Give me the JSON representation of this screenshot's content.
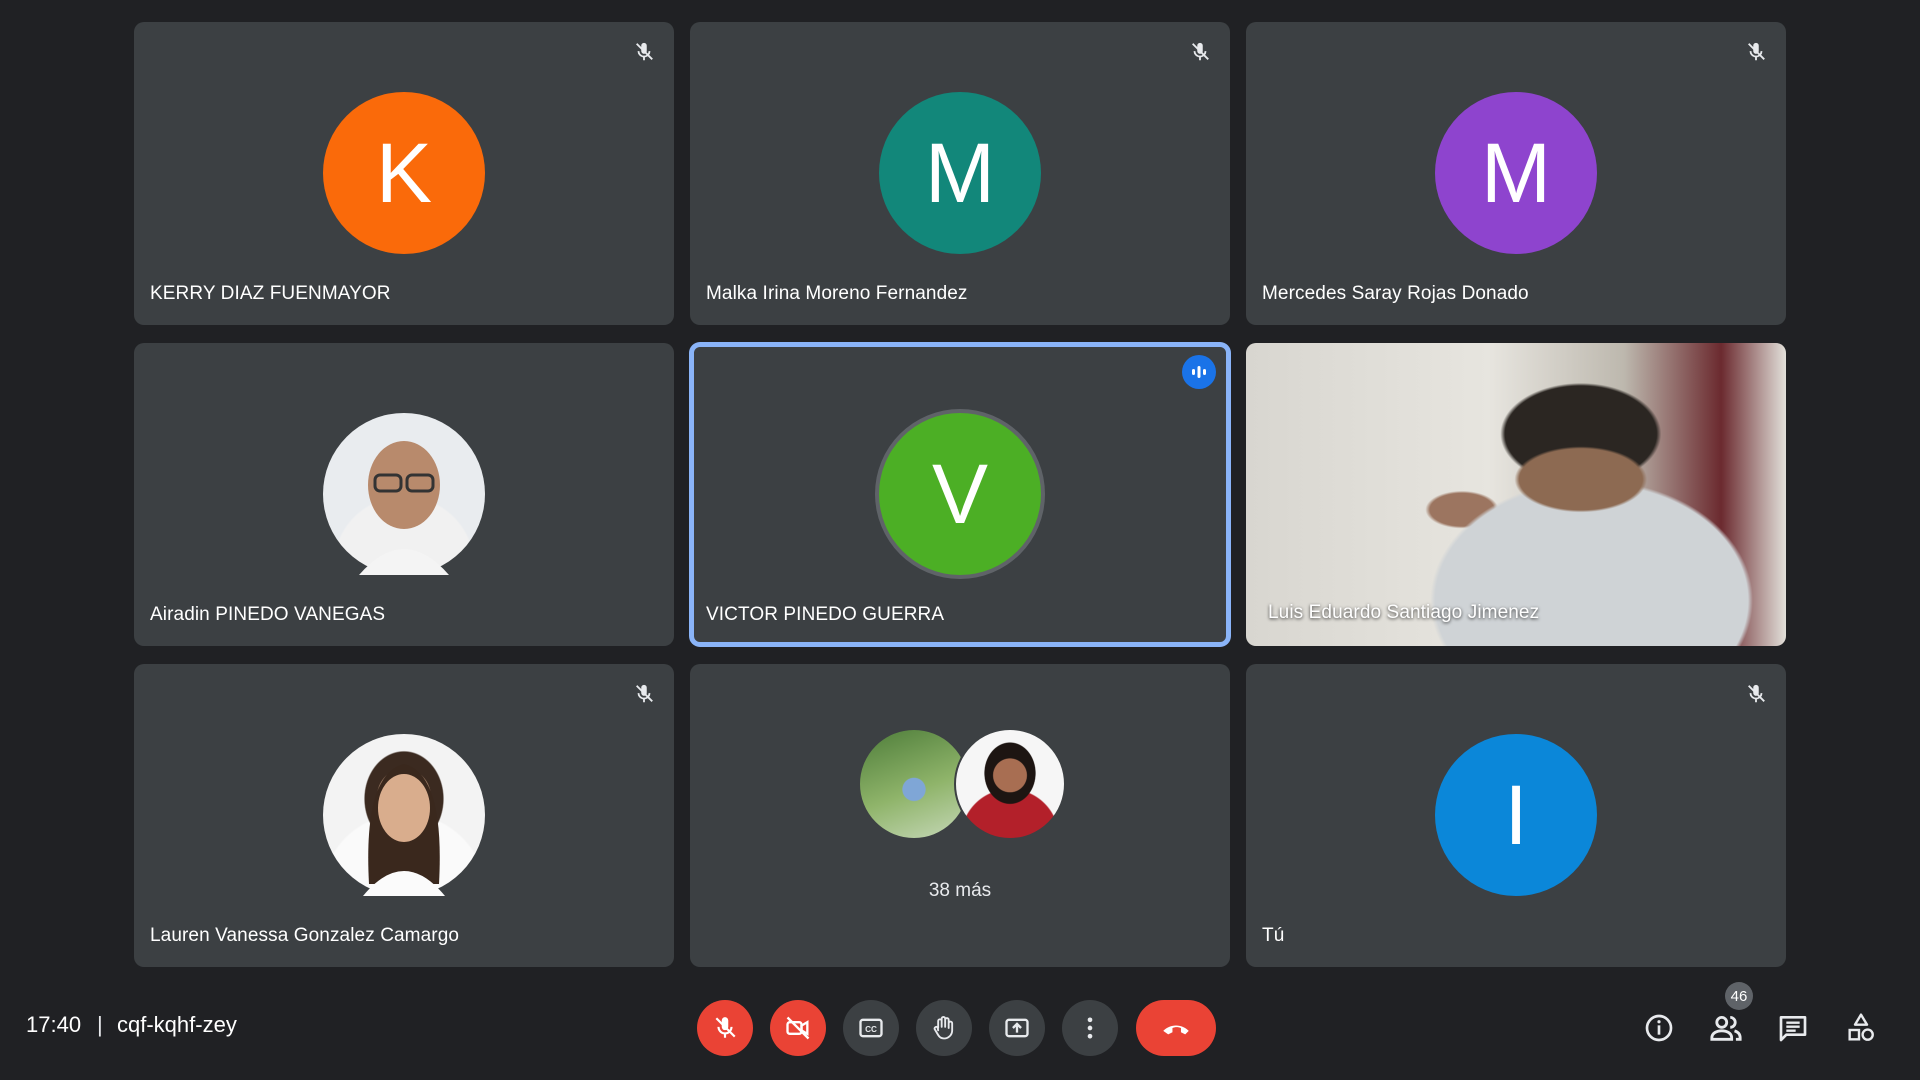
{
  "participants": [
    {
      "name": "KERRY DIAZ FUENMAYOR",
      "initial": "K",
      "avatar_color": "#fa6a0a",
      "muted": true,
      "avatar_type": "letter"
    },
    {
      "name": "Malka Irina Moreno Fernandez",
      "initial": "M",
      "avatar_color": "#12877a",
      "muted": true,
      "avatar_type": "letter"
    },
    {
      "name": "Mercedes Saray Rojas Donado",
      "initial": "M",
      "avatar_color": "#8e44ce",
      "muted": true,
      "avatar_type": "letter"
    },
    {
      "name": "Airadin PINEDO VANEGAS",
      "muted": false,
      "avatar_type": "photo"
    },
    {
      "name": "VICTOR PINEDO GUERRA",
      "initial": "V",
      "avatar_color": "#4caf25",
      "muted": false,
      "speaking": true,
      "avatar_type": "letter"
    },
    {
      "name": "Luis Eduardo Santiago Jimenez",
      "muted": false,
      "avatar_type": "video"
    },
    {
      "name": "Lauren Vanessa Gonzalez Camargo",
      "muted": true,
      "avatar_type": "photo"
    },
    {
      "name": "Tú",
      "initial": "I",
      "avatar_color": "#0b87d9",
      "muted": true,
      "avatar_type": "letter"
    }
  ],
  "others_tile": {
    "label": "38 más"
  },
  "bottom_bar": {
    "time": "17:40",
    "separator": "|",
    "meeting_code": "cqf-kqhf-zey",
    "people_count": "46",
    "icons": {
      "mic": "mic-off-icon",
      "camera": "camera-off-icon",
      "captions": "captions-icon",
      "hand": "raise-hand-icon",
      "present": "present-screen-icon",
      "more": "more-vert-icon",
      "end": "end-call-icon",
      "info": "info-icon",
      "people": "people-icon",
      "chat": "chat-icon",
      "activities": "activities-icon"
    }
  },
  "colors": {
    "background": "#202124",
    "tile": "#3c4043",
    "active_border": "#8ab4f8",
    "danger": "#ea4335",
    "speaking": "#1a73e8"
  }
}
